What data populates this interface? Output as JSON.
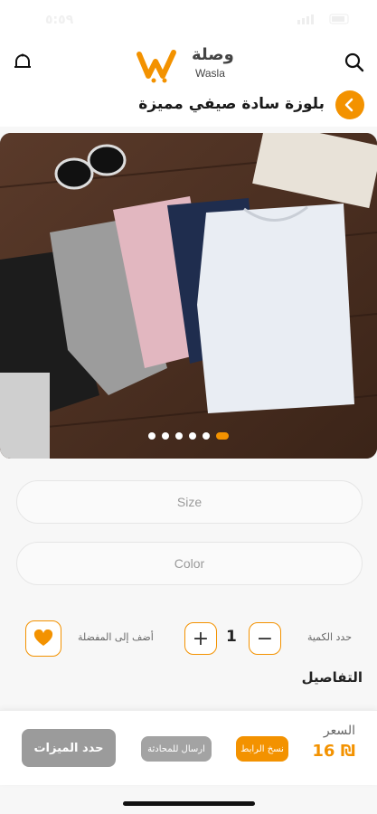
{
  "status_bar": {
    "time": "٥:٥٩"
  },
  "header": {
    "logo_ar": "وصلة",
    "logo_en": "Wasla",
    "bell_icon": "bell-icon",
    "search_icon": "search-icon"
  },
  "product": {
    "title": "بلوزة سادة صيفي مميزة",
    "image_slides": 6,
    "active_slide": 6
  },
  "options": {
    "size_placeholder": "Size",
    "color_placeholder": "Color"
  },
  "quantity": {
    "label": "حدد الكمية",
    "value": "1",
    "plus": "+",
    "minus": "−"
  },
  "favorite": {
    "label": "أضف إلى المفضلة"
  },
  "details": {
    "heading": "التفاصيل"
  },
  "bottom": {
    "price_label": "السعر",
    "price_value": "16 ₪",
    "copy_link": "نسخ الرابط",
    "send_chat": "ارسال للمحادثة",
    "select_features": "حدد الميزات"
  },
  "colors": {
    "accent": "#f39200",
    "button_gray": "#9b9b9b"
  }
}
